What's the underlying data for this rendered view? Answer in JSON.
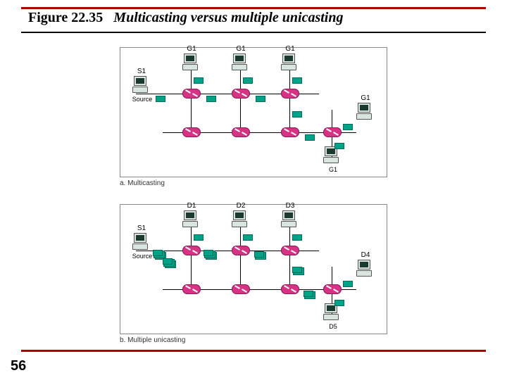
{
  "figure_number": "Figure 22.35",
  "figure_title": "Multicasting versus multiple unicasting",
  "page_number": "56",
  "panel_a": {
    "caption": "a. Multicasting",
    "source": {
      "label": "S1",
      "sublabel": "Source"
    },
    "dest_labels": [
      "G1",
      "G1",
      "G1",
      "G1",
      "G1"
    ]
  },
  "panel_b": {
    "caption": "b. Multiple unicasting",
    "source": {
      "label": "S1",
      "sublabel": "Source"
    },
    "dest_labels": [
      "D1",
      "D2",
      "D3",
      "D4",
      "D5"
    ]
  }
}
